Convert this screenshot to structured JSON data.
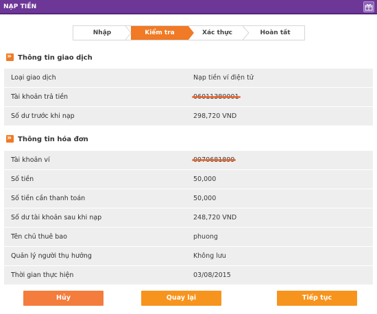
{
  "header": {
    "title": "NẠP TIỀN",
    "gift_icon": "gift-icon"
  },
  "steps": [
    {
      "label": "Nhập",
      "active": false
    },
    {
      "label": "Kiểm tra",
      "active": true
    },
    {
      "label": "Xác thực",
      "active": false
    },
    {
      "label": "Hoàn tất",
      "active": false
    }
  ],
  "transaction": {
    "title": "Thông tin giao dịch",
    "rows": [
      {
        "label": "Loại giao dịch",
        "value": "Nạp tiền ví điện tử"
      },
      {
        "label": "Tài khoản trả tiền",
        "value": "06011380001"
      },
      {
        "label": "Số dư trước khi nạp",
        "value": "298,720 VND"
      }
    ]
  },
  "invoice": {
    "title": "Thông tin hóa đơn",
    "rows": [
      {
        "label": "Tài khoản ví",
        "value": "0970681899"
      },
      {
        "label": "Số tiền",
        "value": "50,000"
      },
      {
        "label": "Số tiền cần thanh toán",
        "value": "50,000"
      },
      {
        "label": "Số dư tài khoản sau khi nạp",
        "value": "248,720 VND"
      },
      {
        "label": "Tên chủ thuê bao",
        "value": "phuong"
      },
      {
        "label": "Quản lý người thụ hưởng",
        "value": "Không lưu"
      },
      {
        "label": "Thời gian thực hiện",
        "value": "03/08/2015"
      }
    ]
  },
  "buttons": {
    "cancel": "Hủy",
    "back": "Quay lại",
    "next": "Tiếp tục"
  },
  "colors": {
    "brand": "#6c3797",
    "accent": "#f07a25",
    "row_bg": "#eeeeee"
  }
}
